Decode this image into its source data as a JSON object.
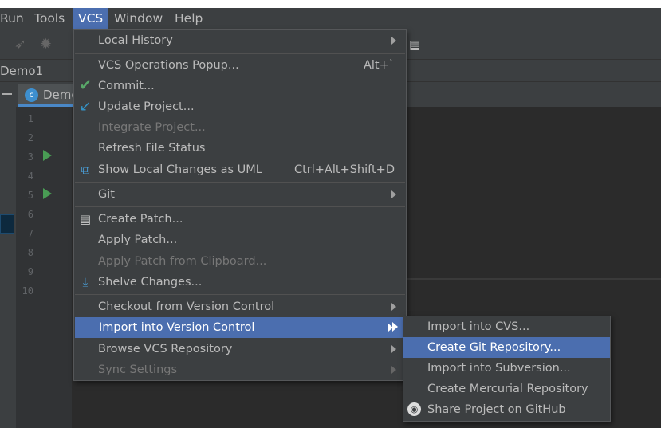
{
  "menubar": {
    "items": [
      "Run",
      "Tools",
      "VCS",
      "Window",
      "Help"
    ],
    "active": "VCS"
  },
  "breadcrumb": {
    "project": "Demo1"
  },
  "editor": {
    "tab": "Demo",
    "line_numbers": [
      "1",
      "2",
      "3",
      "4",
      "5",
      "6",
      "7",
      "8",
      "9",
      "10"
    ]
  },
  "vcs_menu": {
    "local_history": "Local History",
    "vcs_ops": "VCS Operations Popup...",
    "vcs_ops_shortcut": "Alt+`",
    "commit": "Commit...",
    "update": "Update Project...",
    "integrate": "Integrate Project...",
    "refresh": "Refresh File Status",
    "uml": "Show Local Changes as UML",
    "uml_shortcut": "Ctrl+Alt+Shift+D",
    "git": "Git",
    "create_patch": "Create Patch...",
    "apply_patch": "Apply Patch...",
    "apply_clip": "Apply Patch from Clipboard...",
    "shelve": "Shelve Changes...",
    "checkout": "Checkout from Version Control",
    "import": "Import into Version Control",
    "browse": "Browse VCS Repository",
    "sync": "Sync Settings"
  },
  "import_submenu": {
    "items": [
      "Import into CVS...",
      "Create Git Repository...",
      "Import into Subversion...",
      "Create Mercurial Repository",
      "Share Project on GitHub"
    ],
    "selected": "Create Git Repository..."
  },
  "colors": {
    "menu_bg": "#3c3f41",
    "highlight": "#4b6eaf",
    "editor_bg": "#2b2b2b"
  }
}
